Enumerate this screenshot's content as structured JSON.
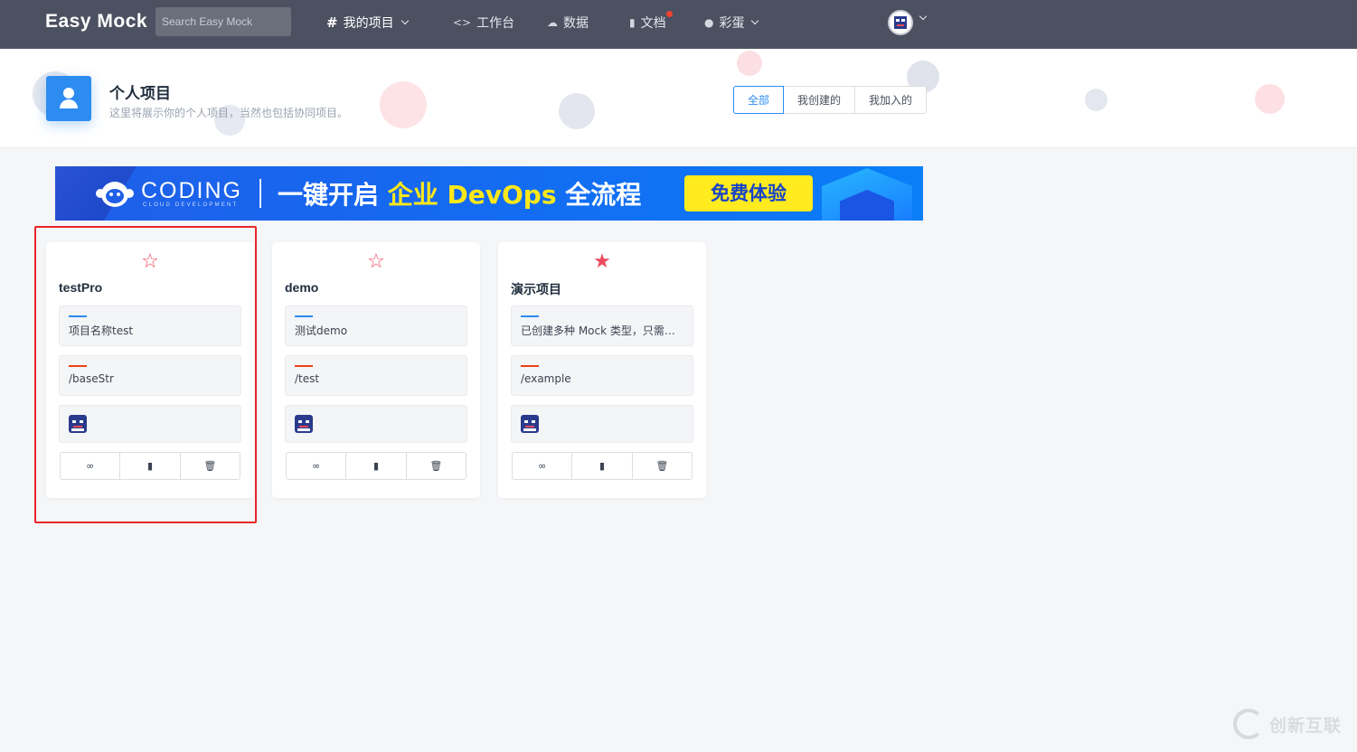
{
  "app": {
    "logo": "Easy Mock",
    "search_placeholder": "Search Easy Mock"
  },
  "nav": [
    {
      "label": "我的项目",
      "icon": "hash-icon",
      "active": true
    },
    {
      "label": "工作台",
      "icon": "code-icon",
      "active": false
    },
    {
      "label": "数据",
      "icon": "cloud-icon",
      "active": false
    },
    {
      "label": "文档",
      "icon": "book-icon",
      "active": false,
      "badge": true
    },
    {
      "label": "彩蛋",
      "icon": "egg-icon",
      "active": false
    }
  ],
  "header": {
    "title": "个人项目",
    "subtitle": "这里将展示你的个人项目，当然也包括协同项目。",
    "filters": [
      "全部",
      "我创建的",
      "我加入的"
    ],
    "active_filter": "全部"
  },
  "banner": {
    "brand": "CODING",
    "brand_sub": "CLOUD DEVELOPMENT",
    "slogan_prefix": "一键开启 ",
    "slogan_highlight": "企业 DevOps",
    "slogan_suffix": " 全流程",
    "cta": "免费体验"
  },
  "projects": [
    {
      "name": "testPro",
      "description": "项目名称test",
      "url": "/baseStr",
      "starred": false
    },
    {
      "name": "demo",
      "description": "测试demo",
      "url": "/test",
      "starred": false
    },
    {
      "name": "演示项目",
      "description": "已创建多种 Mock 类型，只需点击预览便可查看效果。",
      "url": "/example",
      "starred": true
    }
  ],
  "card_actions": [
    "link-icon",
    "copy-icon",
    "trash-icon"
  ],
  "watermark": "创新互联",
  "colors": {
    "topbar": "#4c5161",
    "primary": "#2d8cf0",
    "star": "#ed4b5d",
    "highlight_box": "#e8262b"
  }
}
